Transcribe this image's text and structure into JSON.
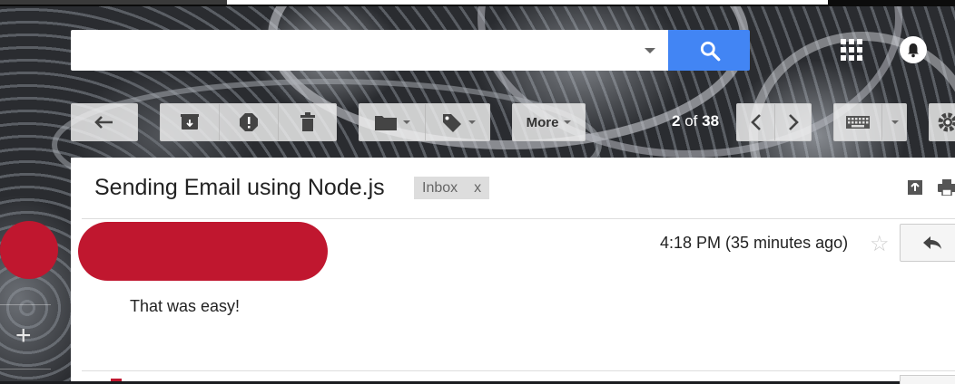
{
  "search": {
    "value": "",
    "placeholder": ""
  },
  "toolbar": {
    "more_label": "More",
    "pager_current": "2",
    "pager_of": "of",
    "pager_total": "38"
  },
  "message": {
    "subject": "Sending Email using Node.js",
    "label": "Inbox",
    "label_remove": "x",
    "time": "4:18 PM (35 minutes ago)",
    "body": "That was easy!"
  },
  "sidebar": {
    "compose_plus": "+"
  },
  "icons": {
    "search": "search-icon",
    "apps": "apps-grid-icon",
    "notifications": "bell-icon",
    "back": "back-arrow-icon",
    "archive": "archive-icon",
    "spam": "report-spam-icon",
    "delete": "trash-icon",
    "move": "folder-icon",
    "labels": "label-tag-icon",
    "older": "chevron-left-icon",
    "newer": "chevron-right-icon",
    "input_tools": "keyboard-icon",
    "settings": "gear-icon",
    "new_window": "open-in-new-window-icon",
    "print": "print-icon",
    "star": "star-icon",
    "reply": "reply-icon"
  },
  "colors": {
    "accent": "#4285f4",
    "redaction": "#c0172f"
  }
}
